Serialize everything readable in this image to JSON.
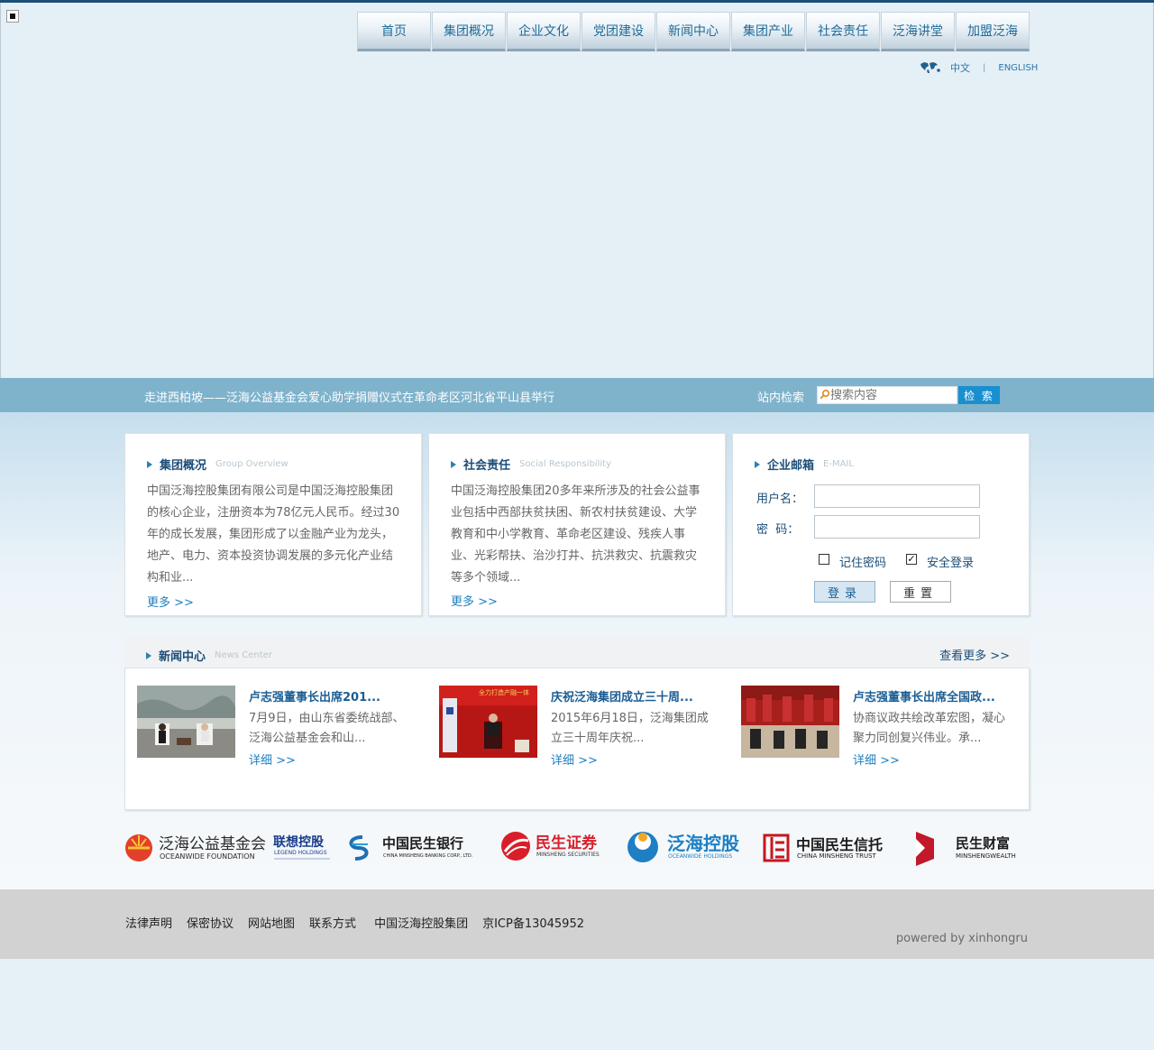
{
  "nav": {
    "items": [
      "首页",
      "集团概况",
      "企业文化",
      "党团建设",
      "新闻中心",
      "集团产业",
      "社会责任",
      "泛海讲堂",
      "加盟泛海"
    ]
  },
  "lang": {
    "cn": "中文",
    "separator": "|",
    "en": "ENGLISH"
  },
  "ticker": {
    "headline": "走进西柏坡——泛海公益基金会爱心助学捐赠仪式在革命老区河北省平山县举行"
  },
  "search": {
    "label": "站内检索",
    "placeholder": "搜索内容",
    "button": "检 索"
  },
  "panels": {
    "overview": {
      "title": "集团概况",
      "subtitle": "Group Overview",
      "body": "中国泛海控股集团有限公司是中国泛海控股集团的核心企业，注册资本为78亿元人民币。经过30年的成长发展，集团形成了以金融产业为龙头，地产、电力、资本投资协调发展的多元化产业结构和业...",
      "more": "更多 >>"
    },
    "responsibility": {
      "title": "社会责任",
      "subtitle": "Social Responsibility",
      "body": "中国泛海控股集团20多年来所涉及的社会公益事业包括中西部扶贫扶困、新农村扶贫建设、大学教育和中小学教育、革命老区建设、残疾人事业、光彩帮扶、治沙打井、抗洪救灾、抗震救灾等多个领域...",
      "more": "更多 >>"
    },
    "email": {
      "title": "企业邮箱",
      "subtitle": "E-MAIL",
      "username_label": "用户名：",
      "password_label": "密  码：",
      "remember_label": "记住密码",
      "remember_checked": false,
      "secure_label": "安全登录",
      "secure_checked": true,
      "login_button": "登录",
      "reset_button": "重置"
    }
  },
  "news": {
    "title": "新闻中心",
    "subtitle": "News Center",
    "more": "查看更多 >>",
    "items": [
      {
        "title": "卢志强董事长出席201...",
        "desc": "7月9日，由山东省委统战部、泛海公益基金会和山...",
        "detail": "详细 >>"
      },
      {
        "title": "庆祝泛海集团成立三十周...",
        "desc": "2015年6月18日，泛海集团成立三十周年庆祝...",
        "detail": "详细 >>"
      },
      {
        "title": "卢志强董事长出席全国政...",
        "desc": "协商议政共绘改革宏图，凝心聚力同创复兴伟业。承...",
        "detail": "详细 >>"
      }
    ],
    "banner_text": "全力打造产融一体"
  },
  "partners": [
    {
      "name": "泛海公益基金会",
      "en": "OCEANWIDE FOUNDATION"
    },
    {
      "name": "联想控股",
      "en": "LEGEND HOLDINGS"
    },
    {
      "name": "中国民生银行",
      "en": "CHINA MINSHENG BANKING CORP., LTD."
    },
    {
      "name": "民生证券",
      "en": "MINSHENG SECURITIES"
    },
    {
      "name": "泛海控股",
      "en": "OCEANWIDE HOLDINGS"
    },
    {
      "name": "中国民生信托",
      "en": "CHINA MINSHENG TRUST"
    },
    {
      "name": "民生财富",
      "en": "MINSHENGWEALTH"
    }
  ],
  "footer": {
    "links": [
      "法律声明",
      "保密协议",
      "网站地图",
      "联系方式",
      "中国泛海控股集团",
      "京ICP备13045952"
    ],
    "powered": "powered by xinhongru"
  },
  "colors": {
    "nav_text": "#1f6b9a",
    "bar": "#7fb3cc",
    "search_button": "#1a8fd0",
    "heading": "#1b4d78",
    "link": "#1d7fc0",
    "footer_bg": "#d2d2d2"
  }
}
